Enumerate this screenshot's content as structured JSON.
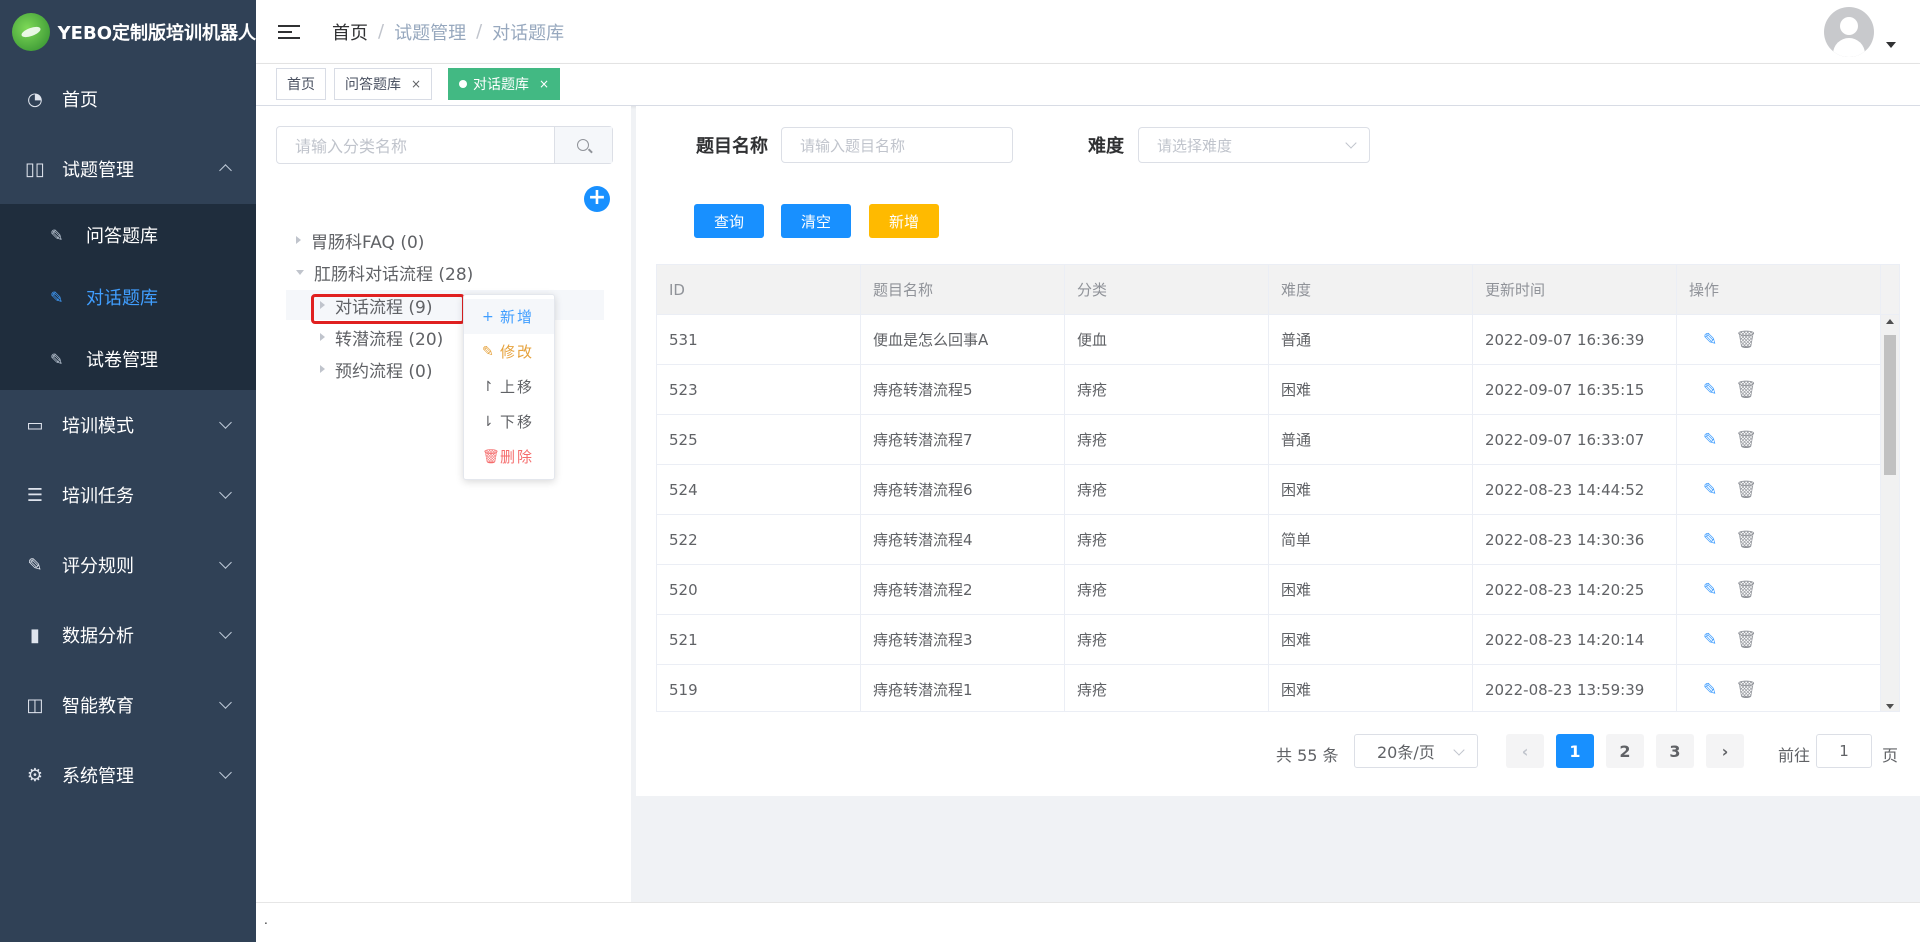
{
  "app": {
    "title": "YEBO定制版培训机器人"
  },
  "sidebar": {
    "items": [
      {
        "label": "首页",
        "icon": "dashboard-icon"
      },
      {
        "label": "试题管理",
        "icon": "book-icon",
        "expanded": true,
        "children": [
          {
            "label": "问答题库",
            "icon": "edit-icon"
          },
          {
            "label": "对话题库",
            "icon": "edit-icon",
            "active": true
          },
          {
            "label": "试卷管理",
            "icon": "edit-icon"
          }
        ]
      },
      {
        "label": "培训模式",
        "icon": "monitor-icon"
      },
      {
        "label": "培训任务",
        "icon": "list-icon"
      },
      {
        "label": "评分规则",
        "icon": "edit-icon"
      },
      {
        "label": "数据分析",
        "icon": "chart-icon"
      },
      {
        "label": "智能教育",
        "icon": "screen-chart-icon"
      },
      {
        "label": "系统管理",
        "icon": "gear-icon"
      }
    ]
  },
  "header": {
    "breadcrumb": [
      "首页",
      "试题管理",
      "对话题库"
    ],
    "separator": "/"
  },
  "tags": [
    {
      "label": "首页",
      "closable": false
    },
    {
      "label": "问答题库",
      "closable": true
    },
    {
      "label": "对话题库",
      "closable": true,
      "active": true
    }
  ],
  "tags_close": "×",
  "tree": {
    "search_placeholder": "请输入分类名称",
    "add_glyph": "+",
    "nodes": [
      {
        "label": "胃肠科FAQ (0)"
      },
      {
        "label": "肛肠科对话流程 (28)"
      },
      {
        "label": "对话流程 (9)"
      },
      {
        "label": "转潜流程 (20)"
      },
      {
        "label": "预约流程 (0)"
      }
    ],
    "context_menu": [
      {
        "label": "新增",
        "icon": "plus-icon",
        "glyph": "+",
        "color": "#409eff"
      },
      {
        "label": "修改",
        "icon": "pencil-icon",
        "glyph": "✎",
        "color": "#e6a23c"
      },
      {
        "label": "上移",
        "icon": "arrow-up-icon",
        "glyph": "↾",
        "color": "#606266"
      },
      {
        "label": "下移",
        "icon": "arrow-down-icon",
        "glyph": "⇂",
        "color": "#606266"
      },
      {
        "label": "删除",
        "icon": "trash-icon",
        "glyph": "🗑",
        "color": "#f56c6c"
      }
    ]
  },
  "filters": {
    "name_label": "题目名称",
    "name_placeholder": "请输入题目名称",
    "difficulty_label": "难度",
    "difficulty_placeholder": "请选择难度"
  },
  "buttons": {
    "query": "查询",
    "clear": "清空",
    "add": "新增",
    "colors": {
      "query": "#1890ff",
      "clear": "#1890ff",
      "add": "#ffba00"
    }
  },
  "table": {
    "columns": [
      "ID",
      "题目名称",
      "分类",
      "难度",
      "更新时间",
      "操作"
    ],
    "rows": [
      [
        "531",
        "便血是怎么回事A",
        "便血",
        "普通",
        "2022-09-07 16:36:39"
      ],
      [
        "523",
        "痔疮转潜流程5",
        "痔疮",
        "困难",
        "2022-09-07 16:35:15"
      ],
      [
        "525",
        "痔疮转潜流程7",
        "痔疮",
        "普通",
        "2022-09-07 16:33:07"
      ],
      [
        "524",
        "痔疮转潜流程6",
        "痔疮",
        "困难",
        "2022-08-23 14:44:52"
      ],
      [
        "522",
        "痔疮转潜流程4",
        "痔疮",
        "简单",
        "2022-08-23 14:30:36"
      ],
      [
        "520",
        "痔疮转潜流程2",
        "痔疮",
        "困难",
        "2022-08-23 14:20:25"
      ],
      [
        "521",
        "痔疮转潜流程3",
        "痔疮",
        "困难",
        "2022-08-23 14:20:14"
      ],
      [
        "519",
        "痔疮转潜流程1",
        "痔疮",
        "困难",
        "2022-08-23 13:59:39"
      ]
    ]
  },
  "pagination": {
    "total": "共 55 条",
    "page_size": "20条/页",
    "pages": [
      "1",
      "2",
      "3"
    ],
    "current": "1",
    "goto_prefix": "前往",
    "goto_value": "1",
    "goto_suffix": "页",
    "prev": "‹",
    "next": "›"
  },
  "footer": {
    "text": "."
  }
}
